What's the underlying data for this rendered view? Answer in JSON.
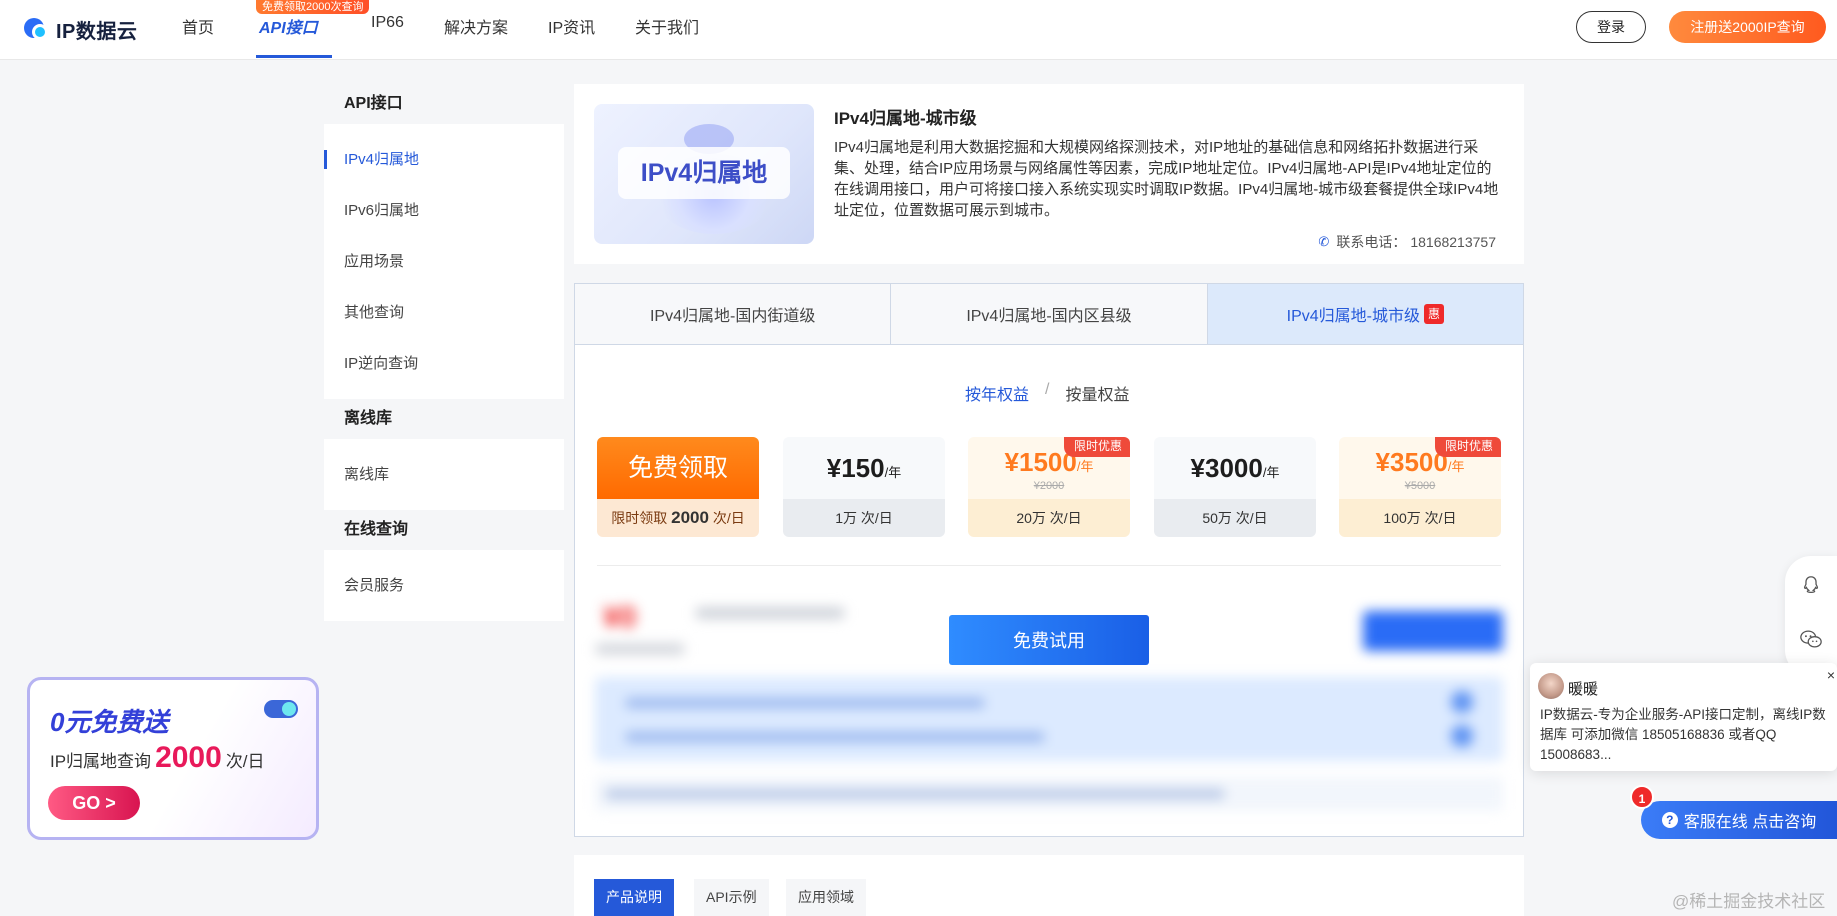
{
  "nav": {
    "logo": "IP数据云",
    "badge": "免费领取2000次查询",
    "items": [
      "首页",
      "API接口",
      "IP66",
      "解决方案",
      "IP资讯",
      "关于我们"
    ],
    "login": "登录",
    "register": "注册送2000IP查询"
  },
  "sidebar": {
    "groups": [
      {
        "title": "API接口",
        "items": [
          "IPv4归属地",
          "IPv6归属地",
          "应用场景",
          "其他查询",
          "IP逆向查询"
        ]
      },
      {
        "title": "离线库",
        "items": [
          "离线库"
        ]
      },
      {
        "title": "在线查询",
        "items": [
          "会员服务"
        ]
      }
    ]
  },
  "product": {
    "image_label": "IPv4归属地",
    "title": "IPv4归属地-城市级",
    "description": "IPv4归属地是利用大数据挖掘和大规模网络探测技术，对IP地址的基础信息和网络拓扑数据进行采集、处理，结合IP应用场景与网络属性等因素，完成IP地址定位。IPv4归属地-API是IPv4地址定位的在线调用接口，用户可将接口接入系统实现实时调取IP数据。IPv4归属地-城市级套餐提供全球IPv4地址定位，位置数据可展示到城市。",
    "phone_label": "联系电话：",
    "phone": "18168213757"
  },
  "tabs": {
    "items": [
      "IPv4归属地-国内街道级",
      "IPv4归属地-国内区县级",
      "IPv4归属地-城市级"
    ],
    "badge": "惠"
  },
  "pricing": {
    "mode_on": "按年权益",
    "mode_sep": "/",
    "mode_off": "按量权益",
    "free": {
      "title": "免费领取",
      "prefix": "限时领取",
      "num": "2000",
      "suffix": "次/日"
    },
    "plans": [
      {
        "price": "¥150",
        "unit": "/年",
        "old": "",
        "quota": "1万 次/日",
        "ribbon": ""
      },
      {
        "price": "¥1500",
        "unit": "/年",
        "old": "¥2000",
        "quota": "20万 次/日",
        "ribbon": "限时优惠"
      },
      {
        "price": "¥3000",
        "unit": "/年",
        "old": "",
        "quota": "50万 次/日",
        "ribbon": ""
      },
      {
        "price": "¥3500",
        "unit": "/年",
        "old": "¥5000",
        "quota": "100万 次/日",
        "ribbon": "限时优惠"
      }
    ],
    "trial_button": "免费试用"
  },
  "bottom_tabs": [
    "产品说明",
    "API示例",
    "应用领域"
  ],
  "promo": {
    "title": "0元免费送",
    "line_prefix": "IP归属地查询",
    "line_num": "2000",
    "line_suffix": "次/日",
    "go": "GO >"
  },
  "chat": {
    "name": "暖暖",
    "close": "×",
    "message": "IP数据云-专为企业服务-API接口定制，离线IP数据库 可添加微信 18505168836 或者QQ 15008683...",
    "service_button": "客服在线 点击咨询",
    "notification_count": "1"
  },
  "watermark": "@稀土掘金技术社区",
  "colors": {
    "brand_blue": "#2559d9",
    "accent_orange": "#ff6a00",
    "badge_red": "#ef2a2a"
  }
}
